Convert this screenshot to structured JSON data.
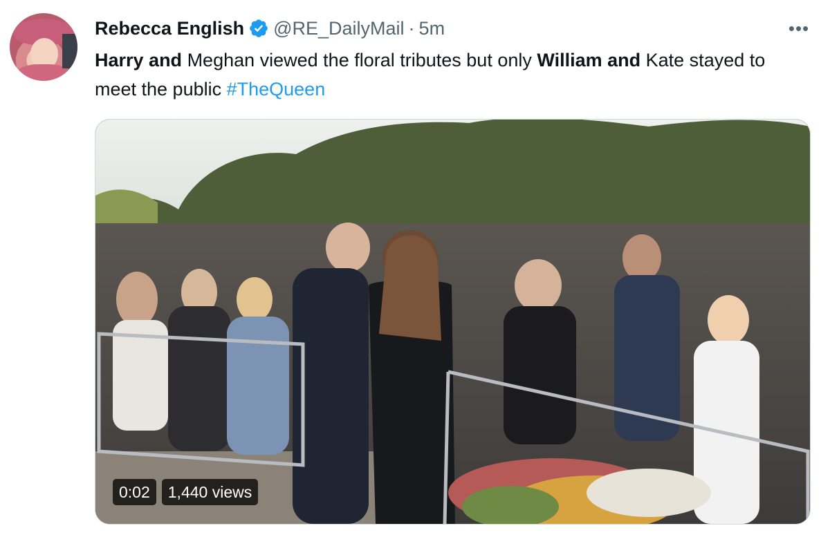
{
  "tweet": {
    "author_name": "Rebecca English",
    "handle": "@RE_DailyMail",
    "separator": "·",
    "time": "5m",
    "more_label": "•••",
    "text_parts": [
      {
        "text": "Harry and",
        "bold": true
      },
      {
        "text": " Meghan viewed the floral tributes but only ",
        "bold": false
      },
      {
        "text": "William and",
        "bold": true
      },
      {
        "text": " Kate stayed to meet the public ",
        "bold": false
      },
      {
        "text": "#TheQueen",
        "hashtag": true
      }
    ],
    "verified_icon": "verified-badge-icon",
    "accent_color": "#1d9bf0"
  },
  "video": {
    "timestamp": "0:02",
    "views": "1,440 views"
  }
}
